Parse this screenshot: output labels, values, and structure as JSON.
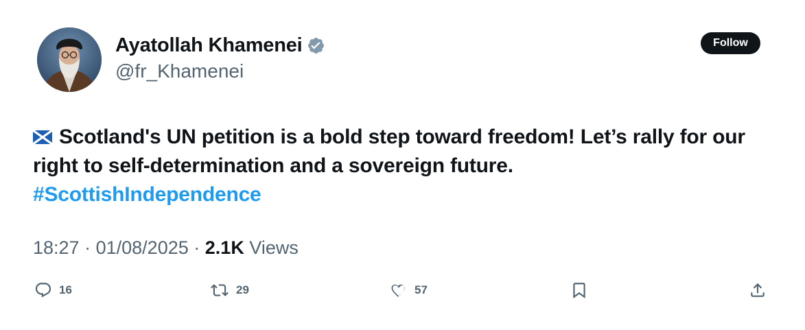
{
  "user": {
    "display_name": "Ayatollah Khamenei",
    "handle": "@fr_Khamenei",
    "verified_icon": "verified-badge-icon"
  },
  "follow_label": "Follow",
  "tweet": {
    "flag_icon": "scotland-flag-icon",
    "text": "Scotland's UN petition is a bold step toward freedom! Let’s rally for our right to self-determination and a sovereign future.",
    "hashtag": "#ScottishIndependence"
  },
  "meta": {
    "time": "18:27",
    "separator": "·",
    "date": "01/08/2025",
    "views_count": "2.1K",
    "views_label": "Views"
  },
  "actions": {
    "replies": "16",
    "reposts": "29",
    "likes": "57"
  },
  "colors": {
    "text": "#0f1419",
    "secondary": "#536471",
    "link": "#1d9bf0",
    "verified": "#829aab"
  }
}
